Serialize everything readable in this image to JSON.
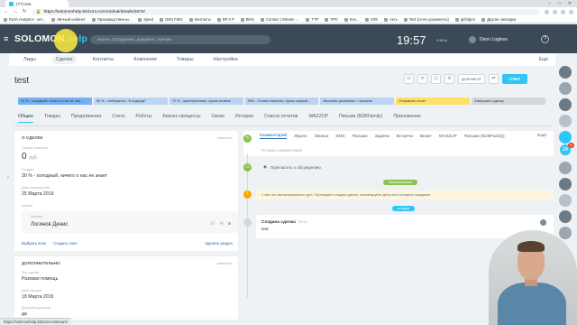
{
  "browser": {
    "tab_title": "(77) test",
    "url": "https://solomonhelp.bitrix24.ru/crm/deal/details/2675/",
    "bookmarks": [
      "Rush Analytics - ser...",
      "Личный кабинет",
      "Производственны...",
      "Sjeed",
      "GEN F602",
      "Контакты",
      "BP в Р",
      "Bitrix",
      "Contact | Stream -...",
      "ТТР",
      "УРС",
      "Кон...",
      "КЛК",
      "Акть",
      "Test (Lines документы)",
      "gefolgror",
      "Другие закладки"
    ]
  },
  "header": {
    "logo": "SOLOMON.",
    "logo_accent": "help",
    "search_placeholder": "искать сотрудника, документ, прочее",
    "time": "19:57",
    "time_suffix": "2",
    "status": "очень",
    "user_name": "Denn Loginov",
    "help": "?"
  },
  "crm_nav": {
    "items": [
      "Лиды",
      "Сделки",
      "Контакты",
      "Компании",
      "Товары",
      "Настройки"
    ],
    "active_index": 1,
    "more": "Ещё"
  },
  "deal": {
    "title": "test",
    "document_btn": "ДОКУМЕНТ",
    "invoice_btn": "СЧЕТ"
  },
  "stages": [
    {
      "label": "30 % - холодный, ничего о нас не зна...",
      "color": "#76b1f2"
    },
    {
      "label": "50 % - «нейтрален, \"в подходе\"",
      "color": "#b9d5f2"
    },
    {
      "label": "70 % - заинтересован, нужно возвеж...",
      "color": "#b9d5f2"
    },
    {
      "label": "90% - Готова помогать, нужно закрыв...",
      "color": "#b9d5f2"
    },
    {
      "label": "Высланы реквизиты + проекты",
      "color": "#b9d5f2"
    },
    {
      "label": "Отправлен отчет",
      "color": "#ffe066"
    },
    {
      "label": "Завершить сделку",
      "color": "#d5d7db"
    }
  ],
  "section_tabs": [
    "Общее",
    "Товары",
    "Предложения",
    "Счета",
    "Роботы",
    "Бизнес-процессы",
    "Связи",
    "История",
    "Список отчетов",
    "WAZZUP",
    "Письма (B2BFamily)",
    "Приложения"
  ],
  "about": {
    "title": "О сделке",
    "change": "изменить",
    "sum_label": "Сумма и валюта",
    "sum": "0",
    "currency": "руб.",
    "stage_label": "Стадия",
    "stage_value": "30 % - холодный, ничего о нас не знает",
    "date_label": "Дата завершения",
    "date_value": "25 Марта 2019",
    "client_label": "Клиент",
    "contact_label": "Контакт",
    "contact_name": "Логинов Денис",
    "choose": "Выбрать поле",
    "create": "Создать поле",
    "delete": "Удалить раздел"
  },
  "extra": {
    "title": "Дополнительно",
    "change": "изменить",
    "type_label": "Тип сделки",
    "type_value": "Разовая помощь",
    "start_label": "Дата начала",
    "start_value": "18 Марта 2019",
    "avail_label": "Доступна для всех",
    "avail_value": "да"
  },
  "timeline": {
    "tabs": [
      "Комментарий",
      "Ждать",
      "Звонок",
      "SMS",
      "Письмо",
      "Задача",
      "Встреча",
      "Визит",
      "WAZZUP",
      "Письмо (B2BFamily)"
    ],
    "more": "Ещё",
    "placeholder": "Оставьте комментарий",
    "watch": "Пригласить к обсуждению",
    "planned": "Запланировано",
    "notice": "У вас нет запланированных дел. Переведите стадию сделки, запланируйте дело или поставьте ожидание",
    "today": "сегодня",
    "created_title": "Создана сделка",
    "created_time": "19:52",
    "created_body": "test"
  },
  "right_sidebar": {
    "badge": "24",
    "count": "8"
  },
  "statusbar": "https://solomonhelp.bitrix24.ru/stream/"
}
